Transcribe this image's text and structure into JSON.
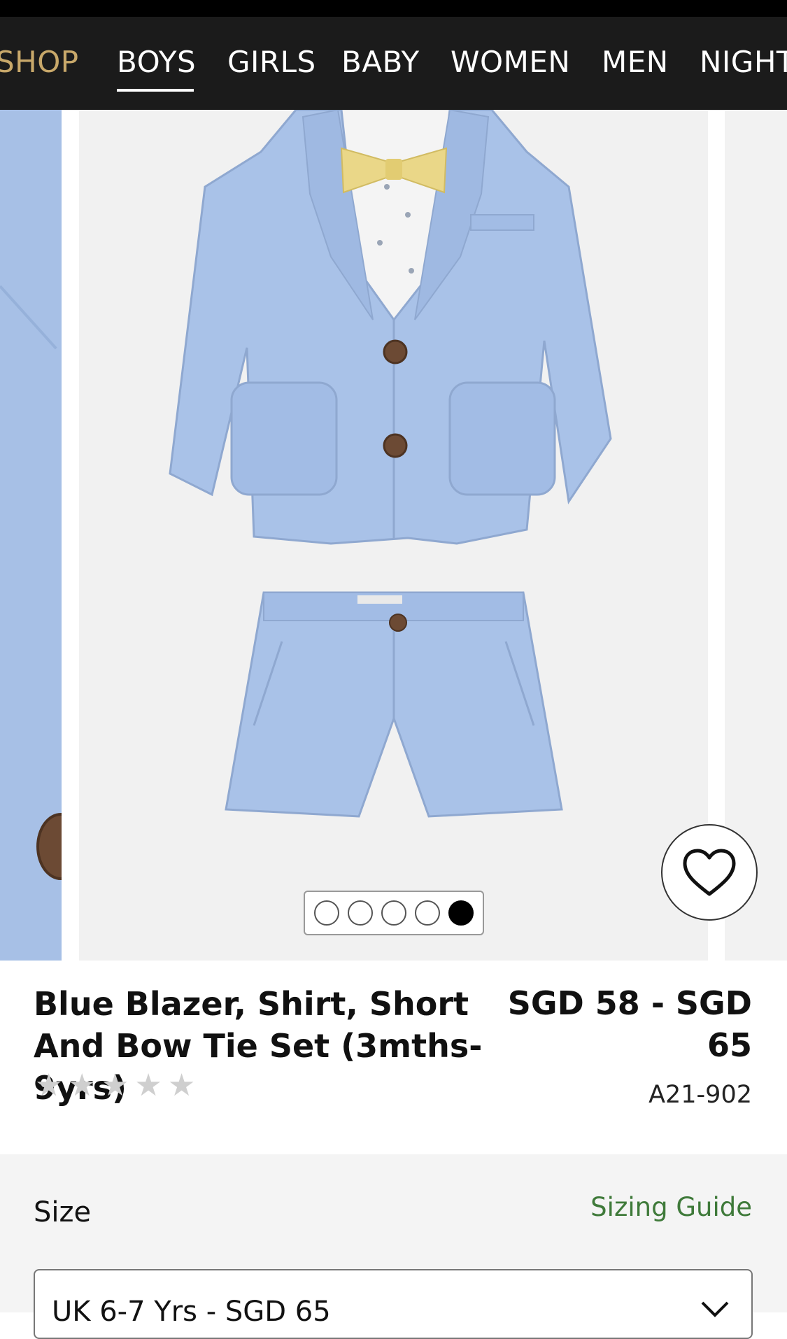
{
  "nav": {
    "items": [
      {
        "label": "SHOP",
        "active": false
      },
      {
        "label": "BOYS",
        "active": true
      },
      {
        "label": "GIRLS",
        "active": false
      },
      {
        "label": "BABY",
        "active": false
      },
      {
        "label": "WOMEN",
        "active": false
      },
      {
        "label": "MEN",
        "active": false
      },
      {
        "label": "NIGHT",
        "active": false
      }
    ]
  },
  "gallery": {
    "image_count": 5,
    "active_index": 4,
    "favorite_icon": "heart-icon"
  },
  "product": {
    "title": "Blue Blazer, Shirt, Short And Bow Tie Set (3mths-9yrs)",
    "price": "SGD 58 - SGD 65",
    "sku": "A21-902",
    "rating": 0,
    "rating_max": 5
  },
  "size": {
    "label": "Size",
    "sizing_guide_label": "Sizing Guide",
    "selected": "UK 6-7 Yrs - SGD 65"
  },
  "colors": {
    "nav_bg": "#1b1b1b",
    "nav_accent": "#c8a86a",
    "sizing_guide": "#3f7a3a",
    "star_empty": "#cfcfcf"
  }
}
